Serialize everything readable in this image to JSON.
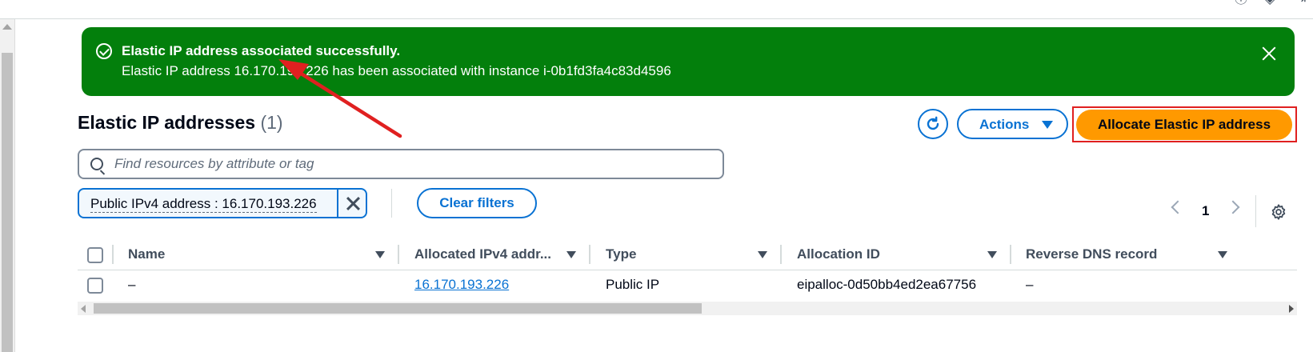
{
  "flash": {
    "title": "Elastic IP address associated successfully.",
    "message": "Elastic IP address 16.170.193.226 has been associated with instance i-0b1fd3fa4c83d4596",
    "background": "#037f0c"
  },
  "header": {
    "title": "Elastic IP addresses",
    "count": "(1)"
  },
  "buttons": {
    "actions": "Actions",
    "allocate": "Allocate Elastic IP address",
    "clear_filters": "Clear filters"
  },
  "search": {
    "placeholder": "Find resources by attribute or tag"
  },
  "filter_token": {
    "label": "Public IPv4 address : 16.170.193.226"
  },
  "pagination": {
    "current_page": "1"
  },
  "table": {
    "columns": [
      "Name",
      "Allocated IPv4 addr...",
      "Type",
      "Allocation ID",
      "Reverse DNS record"
    ],
    "rows": [
      {
        "name": "–",
        "ipv4": "16.170.193.226",
        "type": "Public IP",
        "allocation_id": "eipalloc-0d50bb4ed2ea67756",
        "reverse_dns": "–"
      }
    ]
  },
  "colors": {
    "primary": "#0972d3",
    "accent": "#ff9900",
    "success": "#037f0c",
    "annotation": "#e02020"
  },
  "icons": [
    "check-circle-icon",
    "close-icon",
    "refresh-icon",
    "caret-down-icon",
    "search-icon",
    "dismiss-icon",
    "chevron-left-icon",
    "chevron-right-icon",
    "gear-icon",
    "sort-icon"
  ]
}
